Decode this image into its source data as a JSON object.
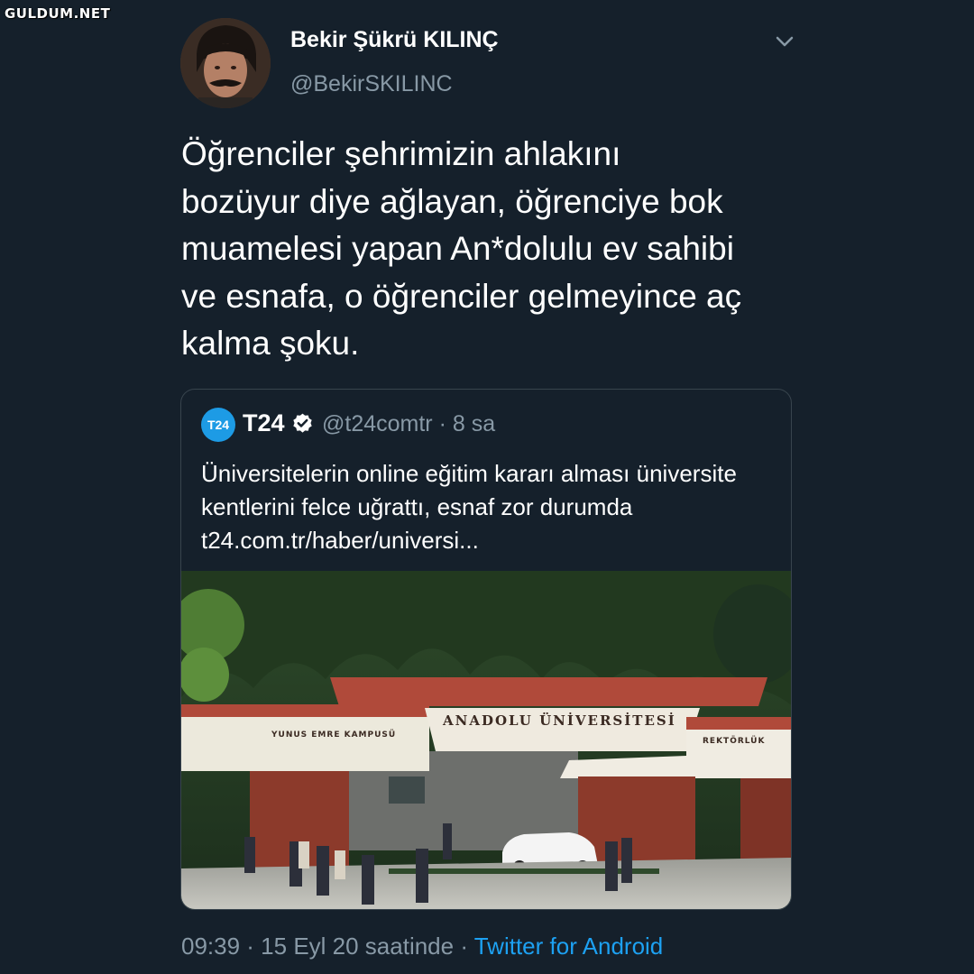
{
  "watermark": "GULDUM.NET",
  "author": {
    "name": "Bekir Şükrü KILINÇ",
    "handle": "@BekirSKILINC"
  },
  "tweet": {
    "text": "Öğrenciler şehrimizin ahlakını\nbozüyur diye ağlayan, öğrenciye bok\nmuamelesi yapan An*dolulu ev sahibi\nve esnafa, o öğrenciler gelmeyince aç\nkalma şoku."
  },
  "quoted": {
    "logo_text": "T24",
    "name": "T24",
    "verified_icon": "verified-badge-icon",
    "handle_time": "@t24comtr · 8 sa",
    "text": "Üniversitelerin online eğitim kararı alması üniversite kentlerini felce uğrattı, esnaf zor durumda",
    "link": "t24.com.tr/haber/universi...",
    "image": {
      "main_sign": "ANADOLU ÜNİVERSİTESİ",
      "left_sign": "YUNUS EMRE KAMPUSÜ",
      "right_sign": "REKTÖRLÜK"
    }
  },
  "meta": {
    "time": "09:39 · 15 Eyl 20 saatinde · ",
    "source": "Twitter for Android"
  },
  "colors": {
    "background": "#15202b",
    "secondary_text": "#8899a6",
    "link": "#1da1f2",
    "border": "#38444d"
  }
}
